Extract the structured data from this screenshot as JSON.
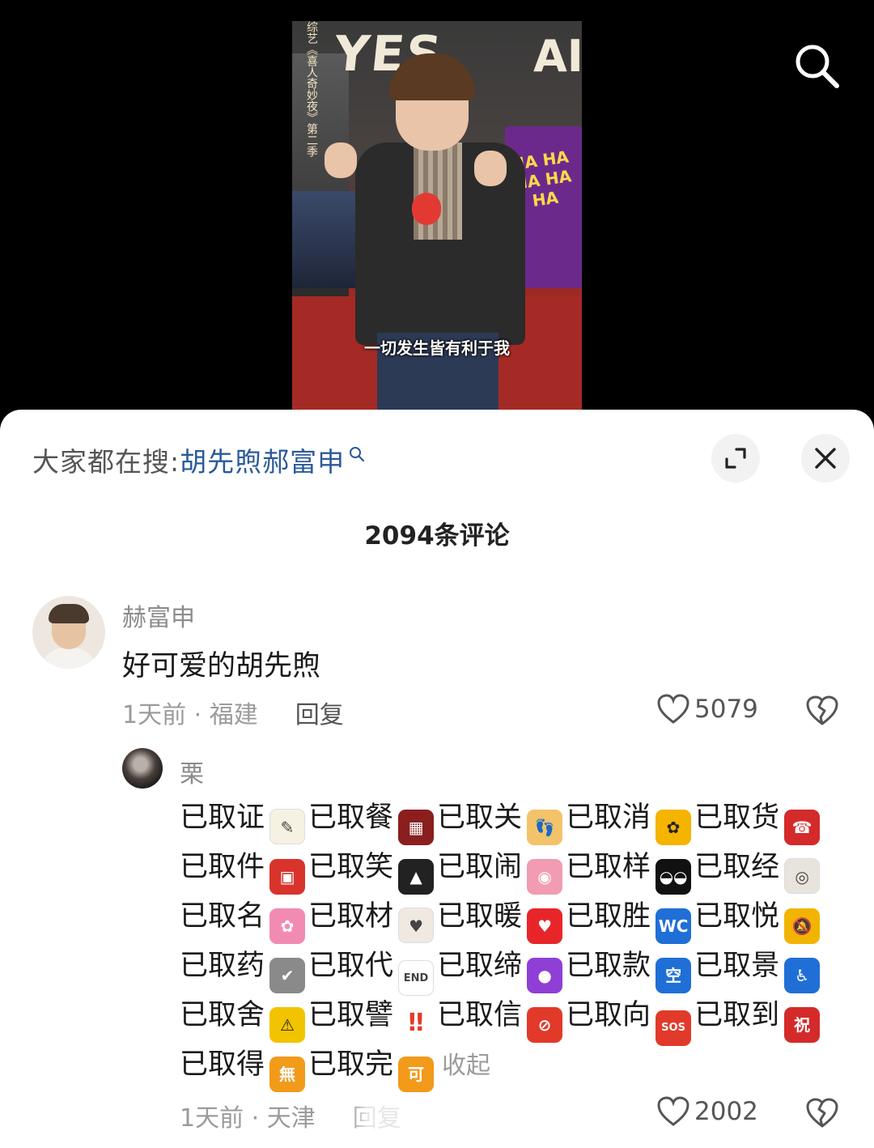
{
  "video": {
    "vertical_caption": "综艺《喜人奇妙夜》第二季",
    "sign_left": "YES",
    "sign_right": "AI",
    "poster_text": "HA HA HA HA HA",
    "subtitle": "一切发生皆有利于我"
  },
  "top_bar": {
    "search_icon": "search-icon"
  },
  "sheet": {
    "hot_search_prefix": "大家都在搜:",
    "hot_search_keyword": "胡先煦郝富申",
    "expand_icon": "expand-icon",
    "close_icon": "close-icon",
    "comment_count": "2094条评论"
  },
  "comments": [
    {
      "username": "赫富申",
      "text": "好可爱的胡先煦",
      "time_location": "1天前 · 福建",
      "reply_label": "回复",
      "likes": "5079"
    }
  ],
  "reply": {
    "username": "栗",
    "lines": [
      [
        {
          "text": "已取证",
          "emoji": "memo",
          "glyph": "✎",
          "color": "#f6f1e2"
        },
        {
          "text": "已取餐",
          "emoji": "bento-box",
          "glyph": "▦",
          "color": "#8b1e1e"
        },
        {
          "text": "已取关",
          "emoji": "footprints",
          "glyph": "👣",
          "color": "#f3c36a"
        },
        {
          "text": "已取消",
          "emoji": "sunflower",
          "glyph": "✿",
          "color": "#f4b400"
        },
        {
          "text": "已取货",
          "emoji": "telephone",
          "glyph": "☎",
          "color": "#d42a2a"
        }
      ],
      [
        {
          "text": "已取件",
          "emoji": "backpack",
          "glyph": "▣",
          "color": "#d8342c"
        },
        {
          "text": "已取笑",
          "emoji": "graduation-cap",
          "glyph": "▲",
          "color": "#222222"
        },
        {
          "text": "已取闹",
          "emoji": "brain",
          "glyph": "◉",
          "color": "#f19cb0"
        },
        {
          "text": "已取样",
          "emoji": "sunglasses",
          "glyph": "◒◒",
          "color": "#111111"
        },
        {
          "text": "已取经",
          "emoji": "toilet-roll",
          "glyph": "◎",
          "color": "#e8e4dc"
        }
      ],
      [
        {
          "text": "已取名",
          "emoji": "ribbon",
          "glyph": "✿",
          "color": "#f28bb3"
        },
        {
          "text": "已取材",
          "emoji": "love-letter",
          "glyph": "♥",
          "color": "#efe9e1"
        },
        {
          "text": "已取暖",
          "emoji": "red-heart",
          "glyph": "♥",
          "color": "#e8262a"
        },
        {
          "text": "已取胜",
          "emoji": "wc-sign",
          "glyph": "WC",
          "color": "#1f6fd6"
        },
        {
          "text": "已取悦",
          "emoji": "bell-slash",
          "glyph": "🔕",
          "color": "#f2b400"
        }
      ],
      [
        {
          "text": "已取药",
          "emoji": "check-box",
          "glyph": "✔",
          "color": "#8a8a8a"
        },
        {
          "text": "已取代",
          "emoji": "end-arrow",
          "glyph": "END",
          "color": "#ffffff"
        },
        {
          "text": "已取缔",
          "emoji": "purple-circle",
          "glyph": "●",
          "color": "#8f3fd6"
        },
        {
          "text": "已取款",
          "emoji": "vacancy-sign",
          "glyph": "空",
          "color": "#1f6fd6"
        },
        {
          "text": "已取景",
          "emoji": "wheelchair-sign",
          "glyph": "♿",
          "color": "#1f6fd6"
        }
      ],
      [
        {
          "text": "已取舍",
          "emoji": "warning-sign",
          "glyph": "⚠",
          "color": "#f2c400"
        },
        {
          "text": "已取譬",
          "emoji": "double-exclamation",
          "glyph": "‼",
          "color": "#ffffff"
        },
        {
          "text": "已取信",
          "emoji": "prohibited-sign",
          "glyph": "⊘",
          "color": "#e23a2a"
        },
        {
          "text": "已取向",
          "emoji": "sos-sign",
          "glyph": "SOS",
          "color": "#e23a2a"
        },
        {
          "text": "已取到",
          "emoji": "congratulations-sign",
          "glyph": "祝",
          "color": "#d42a2a"
        }
      ],
      [
        {
          "text": "已取得",
          "emoji": "free-of-charge-sign",
          "glyph": "無",
          "color": "#f29a1a"
        },
        {
          "text": "已取完",
          "emoji": "acceptable-sign",
          "glyph": "可",
          "color": "#f29a1a"
        }
      ]
    ],
    "collapse_label": "收起",
    "time_location": "1天前 · 天津",
    "reply_label": "回复",
    "likes": "2002"
  },
  "colors": {
    "keyword_blue": "#2b5a9a",
    "meta_gray": "#9b9b9b",
    "sheet_bg": "#ffffff",
    "video_bg": "#000000"
  }
}
